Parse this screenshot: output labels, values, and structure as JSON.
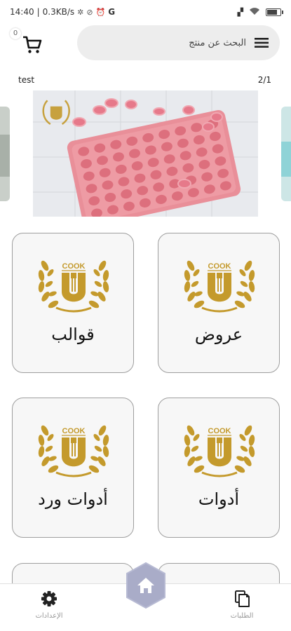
{
  "status_bar": {
    "time": "14:40",
    "network_speed": "0.3KB/s",
    "carrier_icon": "G",
    "battery_level": 0.85
  },
  "header": {
    "cart_count": "0",
    "search_placeholder": "البحث عن منتج"
  },
  "banner": {
    "caption": "test",
    "counter": "2/1"
  },
  "categories": [
    {
      "label": "عروض",
      "logo_text": "COOK"
    },
    {
      "label": "قوالب",
      "logo_text": "COOK"
    },
    {
      "label": "أدوات",
      "logo_text": "COOK"
    },
    {
      "label": "أدوات ورد",
      "logo_text": "COOK"
    }
  ],
  "bottom_nav": {
    "orders_label": "الطلبات",
    "settings_label": "الإعدادات"
  },
  "colors": {
    "accent_gold": "#c49a2c",
    "home_button": "#a9acc8",
    "card_border": "#9e9e9e",
    "banner_mold": "#e98f99"
  }
}
